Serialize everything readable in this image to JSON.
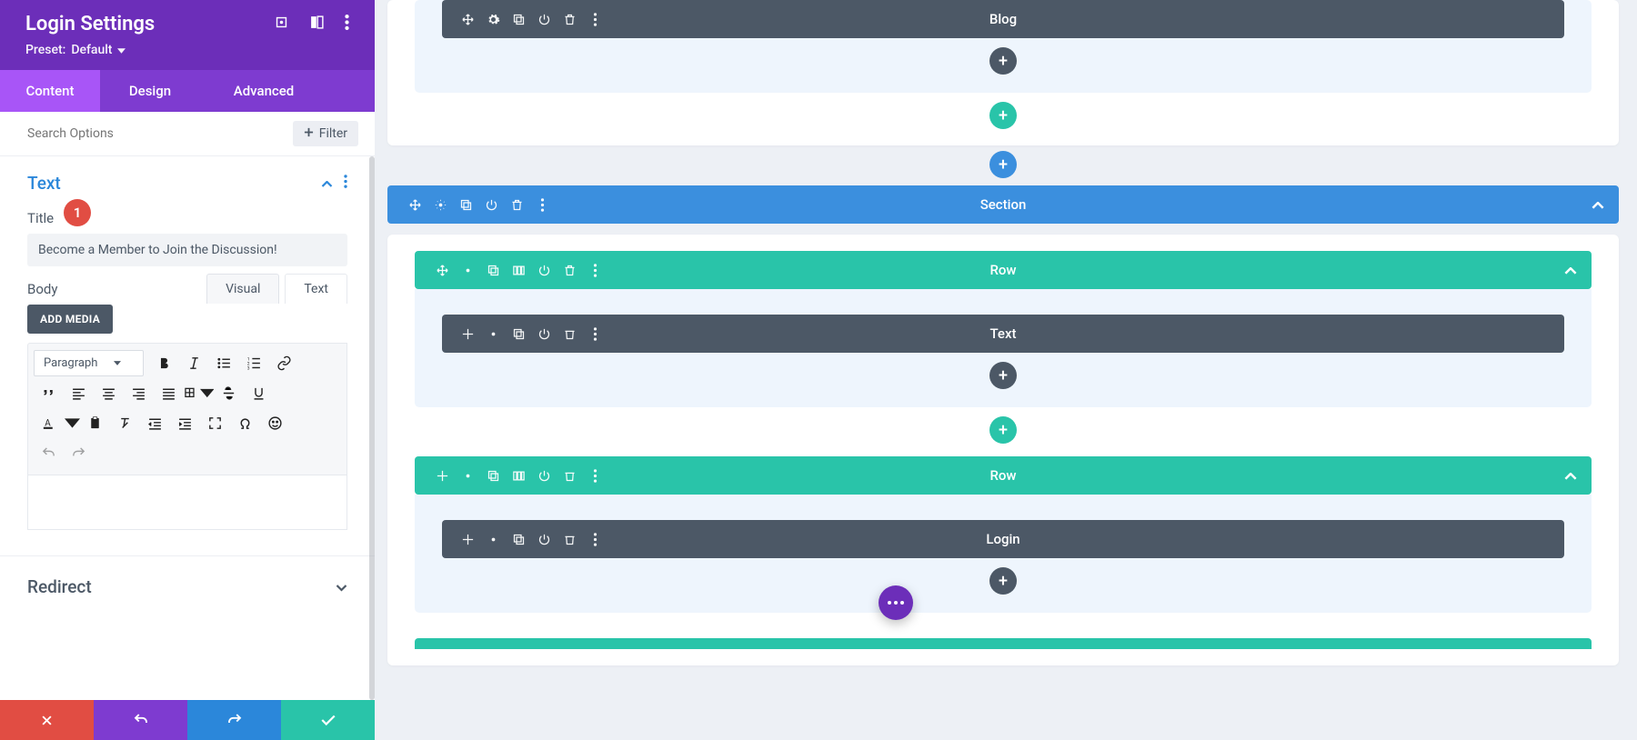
{
  "sidebar": {
    "title": "Login Settings",
    "preset_label": "Preset:",
    "preset_value": "Default",
    "tabs": [
      "Content",
      "Design",
      "Advanced"
    ],
    "active_tab": 0,
    "search_placeholder": "Search Options",
    "filter_label": "Filter",
    "sections": {
      "text": {
        "title": "Text",
        "title_label": "Title",
        "title_value": "Become a Member to Join the Discussion!",
        "badge": "1",
        "body_label": "Body",
        "add_media": "ADD MEDIA",
        "editor_tabs": [
          "Visual",
          "Text"
        ],
        "format_select": "Paragraph"
      },
      "redirect": {
        "title": "Redirect"
      }
    }
  },
  "canvas": {
    "module_blog": "Blog",
    "section_label": "Section",
    "row_label": "Row",
    "module_text": "Text",
    "module_login": "Login"
  },
  "colors": {
    "purple": "#6c2eb9",
    "purple_light": "#a855f7",
    "blue": "#3b8fde",
    "green": "#29c4a9",
    "slate": "#4c5866",
    "red": "#e14d43"
  }
}
